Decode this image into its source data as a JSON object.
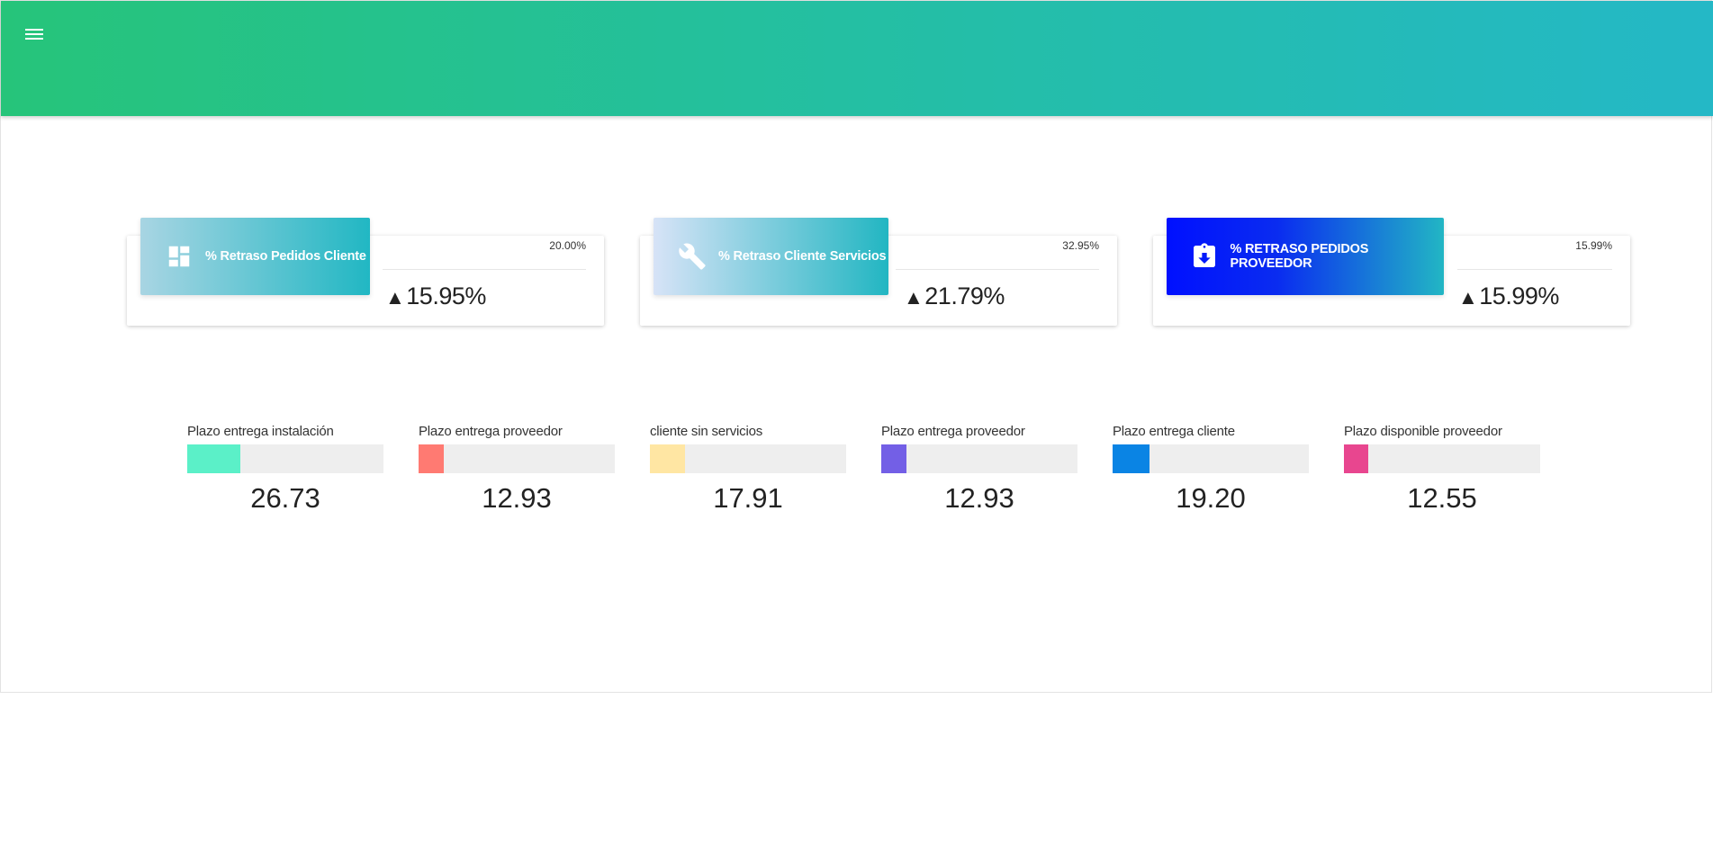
{
  "topbar": {
    "menu_icon": "hamburger-menu-icon",
    "gradient": [
      "#26c47a",
      "#24b8c6"
    ]
  },
  "kpis": [
    {
      "title": "% Retraso Pedidos Cliente",
      "icon": "dashboard-icon",
      "target": "20.00%",
      "value": "15.95%",
      "trend": "up",
      "gradient": [
        "#a8d5e3",
        "#21b7c3"
      ]
    },
    {
      "title": "% Retraso Cliente Servicios",
      "icon": "wrench-icon",
      "target": "32.95%",
      "value": "21.79%",
      "trend": "up",
      "gradient": [
        "#d7e3f7",
        "#22b6c2"
      ]
    },
    {
      "title": "% RETRASO PEDIDOS PROVEEDOR",
      "icon": "clipboard-download-icon",
      "target": "15.99%",
      "value": "15.99%",
      "trend": "up",
      "gradient": [
        "#0010ff",
        "#22b6c4"
      ]
    }
  ],
  "metrics": [
    {
      "label": "Plazo entrega instalación",
      "value": "26.73",
      "color": "#5bf0c8",
      "fill_fraction": 0.27
    },
    {
      "label": "Plazo entrega proveedor",
      "value": "12.93",
      "color": "#ff7a72",
      "fill_fraction": 0.13
    },
    {
      "label": "cliente sin servicios",
      "value": "17.91",
      "color": "#ffe6a3",
      "fill_fraction": 0.18
    },
    {
      "label": "Plazo entrega proveedor",
      "value": "12.93",
      "color": "#735fe6",
      "fill_fraction": 0.13
    },
    {
      "label": "Plazo entrega cliente",
      "value": "19.20",
      "color": "#0a84e4",
      "fill_fraction": 0.19
    },
    {
      "label": "Plazo disponible proveedor",
      "value": "12.55",
      "color": "#e8468f",
      "fill_fraction": 0.125
    }
  ]
}
